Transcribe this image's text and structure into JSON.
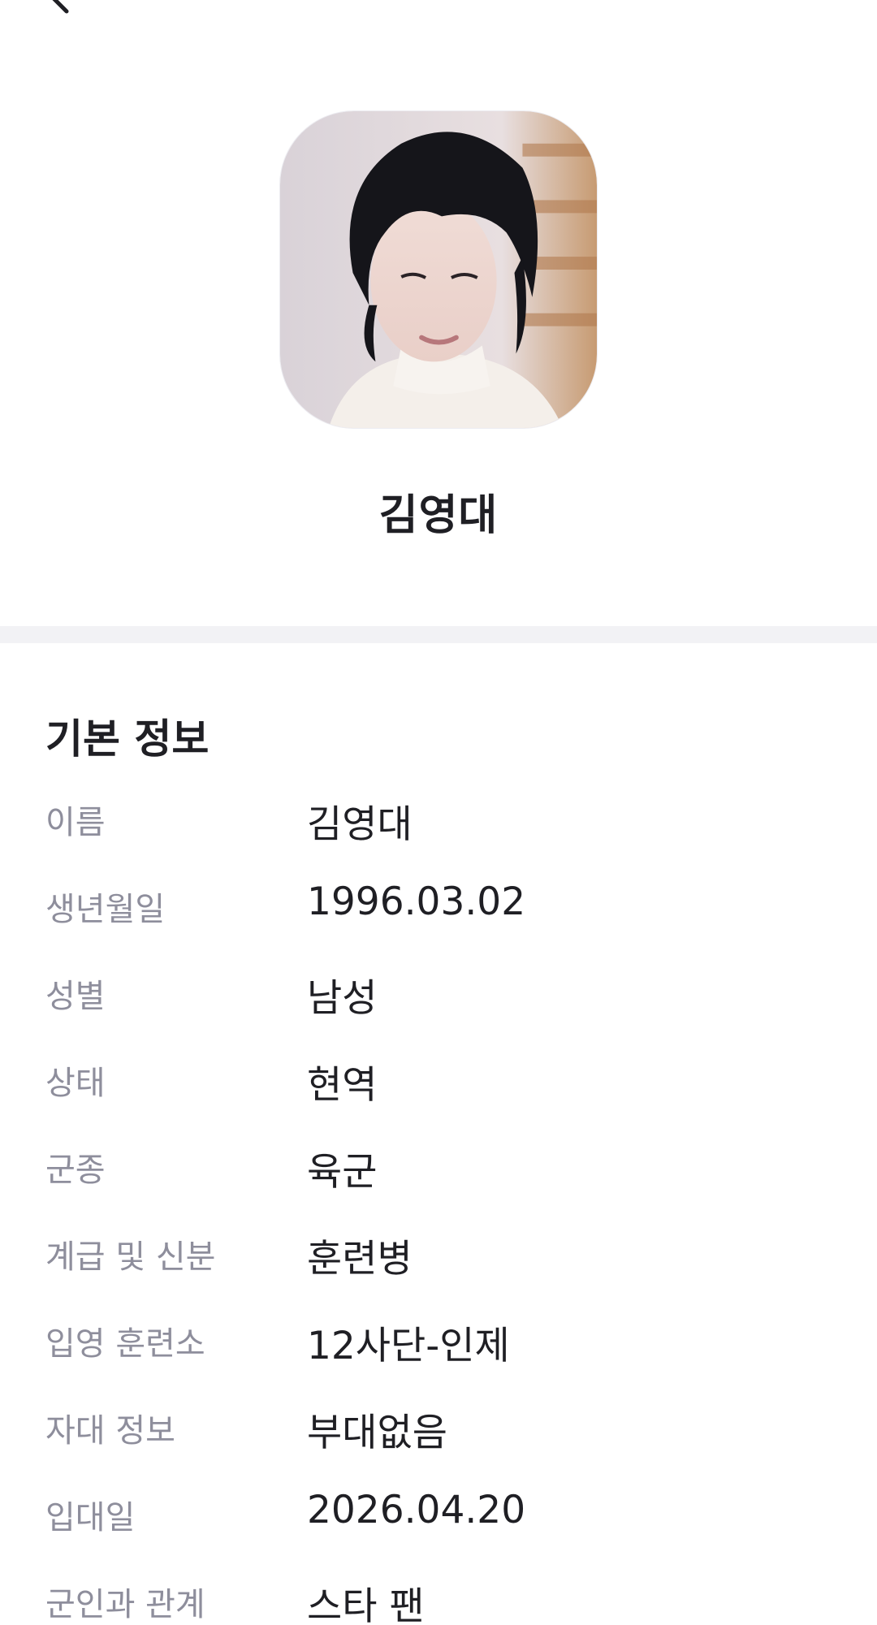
{
  "header": {
    "back_icon": "chevron-left-icon"
  },
  "profile": {
    "name": "김영대",
    "avatar_alt": "profile photo"
  },
  "basic_info": {
    "title": "기본 정보",
    "rows": [
      {
        "label": "이름",
        "value": "김영대"
      },
      {
        "label": "생년월일",
        "value": "1996.03.02"
      },
      {
        "label": "성별",
        "value": "남성"
      },
      {
        "label": "상태",
        "value": "현역"
      },
      {
        "label": "군종",
        "value": "육군"
      },
      {
        "label": "계급 및 신분",
        "value": "훈련병"
      },
      {
        "label": "입영 훈련소",
        "value": "12사단-인제"
      },
      {
        "label": "자대 정보",
        "value": "부대없음"
      },
      {
        "label": "입대일",
        "value": "2026.04.20"
      },
      {
        "label": "군인과 관계",
        "value": "스타 팬"
      }
    ]
  },
  "colors": {
    "text_primary": "#1f1f24",
    "text_secondary": "#8e8e9c",
    "divider": "#f2f2f5"
  }
}
